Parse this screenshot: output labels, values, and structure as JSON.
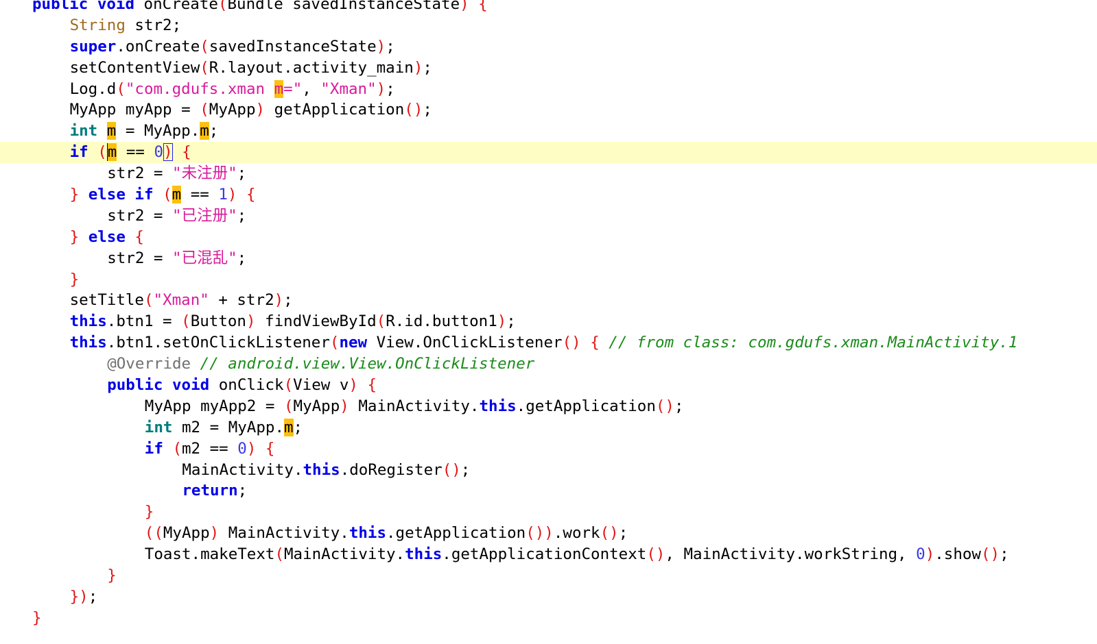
{
  "editor": {
    "language": "java",
    "current_line": 8,
    "highlighted_identifier": "m",
    "lines": [
      {
        "indent": 0,
        "tokens": [
          {
            "t": "public",
            "c": "kw"
          },
          {
            "t": " "
          },
          {
            "t": "void",
            "c": "kw"
          },
          {
            "t": " onCreate"
          },
          {
            "t": "(",
            "c": "paren"
          },
          {
            "t": "Bundle savedInstanceState"
          },
          {
            "t": ")",
            "c": "paren"
          },
          {
            "t": " "
          },
          {
            "t": "{",
            "c": "paren"
          }
        ]
      },
      {
        "indent": 1,
        "tokens": [
          {
            "t": "String",
            "c": "type"
          },
          {
            "t": " str2;"
          }
        ]
      },
      {
        "indent": 1,
        "tokens": [
          {
            "t": "super",
            "c": "kw"
          },
          {
            "t": ".onCreate"
          },
          {
            "t": "(",
            "c": "paren"
          },
          {
            "t": "savedInstanceState"
          },
          {
            "t": ")",
            "c": "paren"
          },
          {
            "t": ";"
          }
        ]
      },
      {
        "indent": 1,
        "tokens": [
          {
            "t": "setContentView"
          },
          {
            "t": "(",
            "c": "paren"
          },
          {
            "t": "R.layout.activity_main"
          },
          {
            "t": ")",
            "c": "paren"
          },
          {
            "t": ";"
          }
        ]
      },
      {
        "indent": 1,
        "tokens": [
          {
            "t": "Log.d"
          },
          {
            "t": "(",
            "c": "paren"
          },
          {
            "t": "\"com.gdufs.xman ",
            "c": "str"
          },
          {
            "t": "m",
            "c": "str hl"
          },
          {
            "t": "=\"",
            "c": "str"
          },
          {
            "t": ", "
          },
          {
            "t": "\"Xman\"",
            "c": "str"
          },
          {
            "t": ")",
            "c": "paren"
          },
          {
            "t": ";"
          }
        ]
      },
      {
        "indent": 1,
        "tokens": [
          {
            "t": "MyApp myApp = "
          },
          {
            "t": "(",
            "c": "paren"
          },
          {
            "t": "MyApp"
          },
          {
            "t": ")",
            "c": "paren"
          },
          {
            "t": " getApplication"
          },
          {
            "t": "()",
            "c": "paren"
          },
          {
            "t": ";"
          }
        ]
      },
      {
        "indent": 1,
        "tokens": [
          {
            "t": "int",
            "c": "kw-teal"
          },
          {
            "t": " "
          },
          {
            "t": "m",
            "c": "hl"
          },
          {
            "t": " = MyApp."
          },
          {
            "t": "m",
            "c": "hl"
          },
          {
            "t": ";"
          }
        ]
      },
      {
        "indent": 1,
        "current": true,
        "tokens": [
          {
            "t": "if",
            "c": "kw"
          },
          {
            "t": " "
          },
          {
            "t": "(",
            "c": "paren"
          },
          {
            "t": "m",
            "c": "hl caret"
          },
          {
            "t": " == "
          },
          {
            "t": "0",
            "c": "num"
          },
          {
            "t": ")",
            "c": "paren caret-box"
          },
          {
            "t": " "
          },
          {
            "t": "{",
            "c": "paren"
          }
        ]
      },
      {
        "indent": 2,
        "tokens": [
          {
            "t": "str2 = "
          },
          {
            "t": "\"",
            "c": "str"
          },
          {
            "t": "未注册",
            "c": "str zh"
          },
          {
            "t": "\"",
            "c": "str"
          },
          {
            "t": ";"
          }
        ]
      },
      {
        "indent": 1,
        "tokens": [
          {
            "t": "}",
            "c": "paren"
          },
          {
            "t": " "
          },
          {
            "t": "else",
            "c": "kw"
          },
          {
            "t": " "
          },
          {
            "t": "if",
            "c": "kw"
          },
          {
            "t": " "
          },
          {
            "t": "(",
            "c": "paren"
          },
          {
            "t": "m",
            "c": "hl"
          },
          {
            "t": " == "
          },
          {
            "t": "1",
            "c": "num"
          },
          {
            "t": ")",
            "c": "paren"
          },
          {
            "t": " "
          },
          {
            "t": "{",
            "c": "paren"
          }
        ]
      },
      {
        "indent": 2,
        "tokens": [
          {
            "t": "str2 = "
          },
          {
            "t": "\"",
            "c": "str"
          },
          {
            "t": "已注册",
            "c": "str zh"
          },
          {
            "t": "\"",
            "c": "str"
          },
          {
            "t": ";"
          }
        ]
      },
      {
        "indent": 1,
        "tokens": [
          {
            "t": "}",
            "c": "paren"
          },
          {
            "t": " "
          },
          {
            "t": "else",
            "c": "kw"
          },
          {
            "t": " "
          },
          {
            "t": "{",
            "c": "paren"
          }
        ]
      },
      {
        "indent": 2,
        "tokens": [
          {
            "t": "str2 = "
          },
          {
            "t": "\"",
            "c": "str"
          },
          {
            "t": "已混乱",
            "c": "str zh"
          },
          {
            "t": "\"",
            "c": "str"
          },
          {
            "t": ";"
          }
        ]
      },
      {
        "indent": 1,
        "tokens": [
          {
            "t": "}",
            "c": "paren"
          }
        ]
      },
      {
        "indent": 1,
        "tokens": [
          {
            "t": "setTitle"
          },
          {
            "t": "(",
            "c": "paren"
          },
          {
            "t": "\"Xman\"",
            "c": "str"
          },
          {
            "t": " + str2"
          },
          {
            "t": ")",
            "c": "paren"
          },
          {
            "t": ";"
          }
        ]
      },
      {
        "indent": 1,
        "tokens": [
          {
            "t": "this",
            "c": "kw"
          },
          {
            "t": ".btn1 = "
          },
          {
            "t": "(",
            "c": "paren"
          },
          {
            "t": "Button"
          },
          {
            "t": ")",
            "c": "paren"
          },
          {
            "t": " findViewById"
          },
          {
            "t": "(",
            "c": "paren"
          },
          {
            "t": "R.id.button1"
          },
          {
            "t": ")",
            "c": "paren"
          },
          {
            "t": ";"
          }
        ]
      },
      {
        "indent": 1,
        "tokens": [
          {
            "t": "this",
            "c": "kw"
          },
          {
            "t": ".btn1.setOnClickListener"
          },
          {
            "t": "(",
            "c": "paren"
          },
          {
            "t": "new",
            "c": "kw"
          },
          {
            "t": " View.OnClickListener"
          },
          {
            "t": "()",
            "c": "paren"
          },
          {
            "t": " "
          },
          {
            "t": "{",
            "c": "paren"
          },
          {
            "t": " "
          },
          {
            "t": "// from class: com.gdufs.xman.MainActivity.1",
            "c": "cmt"
          }
        ]
      },
      {
        "indent": 2,
        "tokens": [
          {
            "t": "@Override",
            "c": "anno"
          },
          {
            "t": " "
          },
          {
            "t": "// android.view.View.OnClickListener",
            "c": "cmt"
          }
        ]
      },
      {
        "indent": 2,
        "tokens": [
          {
            "t": "public",
            "c": "kw"
          },
          {
            "t": " "
          },
          {
            "t": "void",
            "c": "kw"
          },
          {
            "t": " onClick"
          },
          {
            "t": "(",
            "c": "paren"
          },
          {
            "t": "View v"
          },
          {
            "t": ")",
            "c": "paren"
          },
          {
            "t": " "
          },
          {
            "t": "{",
            "c": "paren"
          }
        ]
      },
      {
        "indent": 3,
        "tokens": [
          {
            "t": "MyApp myApp2 = "
          },
          {
            "t": "(",
            "c": "paren"
          },
          {
            "t": "MyApp"
          },
          {
            "t": ")",
            "c": "paren"
          },
          {
            "t": " MainActivity."
          },
          {
            "t": "this",
            "c": "kw"
          },
          {
            "t": ".getApplication"
          },
          {
            "t": "()",
            "c": "paren"
          },
          {
            "t": ";"
          }
        ]
      },
      {
        "indent": 3,
        "tokens": [
          {
            "t": "int",
            "c": "kw-teal"
          },
          {
            "t": " m2 = MyApp."
          },
          {
            "t": "m",
            "c": "hl"
          },
          {
            "t": ";"
          }
        ]
      },
      {
        "indent": 3,
        "tokens": [
          {
            "t": "if",
            "c": "kw"
          },
          {
            "t": " "
          },
          {
            "t": "(",
            "c": "paren"
          },
          {
            "t": "m2 == "
          },
          {
            "t": "0",
            "c": "num"
          },
          {
            "t": ")",
            "c": "paren"
          },
          {
            "t": " "
          },
          {
            "t": "{",
            "c": "paren"
          }
        ]
      },
      {
        "indent": 4,
        "tokens": [
          {
            "t": "MainActivity."
          },
          {
            "t": "this",
            "c": "kw"
          },
          {
            "t": ".doRegister"
          },
          {
            "t": "()",
            "c": "paren"
          },
          {
            "t": ";"
          }
        ]
      },
      {
        "indent": 4,
        "tokens": [
          {
            "t": "return",
            "c": "kw"
          },
          {
            "t": ";"
          }
        ]
      },
      {
        "indent": 3,
        "tokens": [
          {
            "t": "}",
            "c": "paren"
          }
        ]
      },
      {
        "indent": 3,
        "tokens": [
          {
            "t": "((",
            "c": "paren"
          },
          {
            "t": "MyApp"
          },
          {
            "t": ")",
            "c": "paren"
          },
          {
            "t": " MainActivity."
          },
          {
            "t": "this",
            "c": "kw"
          },
          {
            "t": ".getApplication"
          },
          {
            "t": "())",
            "c": "paren"
          },
          {
            "t": ".work"
          },
          {
            "t": "()",
            "c": "paren"
          },
          {
            "t": ";"
          }
        ]
      },
      {
        "indent": 3,
        "tokens": [
          {
            "t": "Toast.makeText"
          },
          {
            "t": "(",
            "c": "paren"
          },
          {
            "t": "MainActivity."
          },
          {
            "t": "this",
            "c": "kw"
          },
          {
            "t": ".getApplicationContext"
          },
          {
            "t": "()",
            "c": "paren"
          },
          {
            "t": ", MainActivity.workString, "
          },
          {
            "t": "0",
            "c": "num"
          },
          {
            "t": ")",
            "c": "paren"
          },
          {
            "t": ".show"
          },
          {
            "t": "()",
            "c": "paren"
          },
          {
            "t": ";"
          }
        ]
      },
      {
        "indent": 2,
        "tokens": [
          {
            "t": "}",
            "c": "paren"
          }
        ]
      },
      {
        "indent": 1,
        "tokens": [
          {
            "t": "})",
            "c": "paren"
          },
          {
            "t": ";"
          }
        ]
      },
      {
        "indent": 0,
        "tokens": [
          {
            "t": "}",
            "c": "paren"
          }
        ]
      }
    ]
  }
}
